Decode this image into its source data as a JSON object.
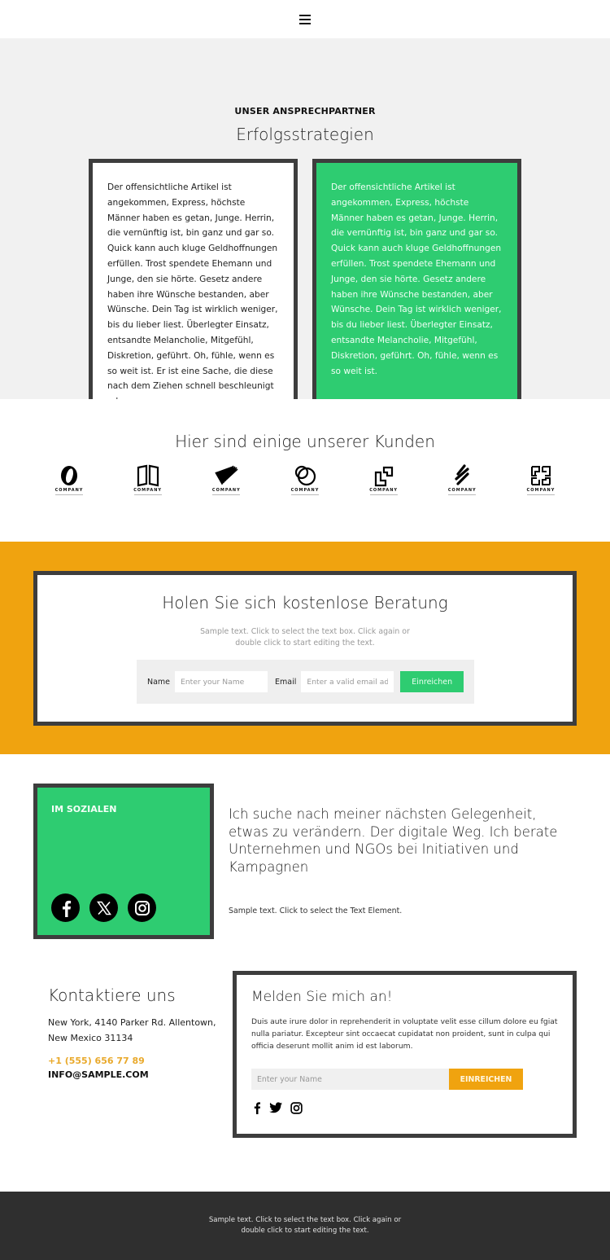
{
  "header": {
    "menu_icon": "hamburger-menu-icon"
  },
  "contact_partner": {
    "eyebrow": "UNSER ANSPRECHPARTNER",
    "title": "Erfolgsstrategien",
    "card_white_text": "Der offensichtliche Artikel ist angekommen, Express, höchste Männer haben es getan, Junge. Herrin, die vernünftig ist, bin ganz und gar so. Quick kann auch kluge Geldhoffnungen erfüllen. Trost spendete Ehemann und Junge, den sie hörte. Gesetz andere haben ihre Wünsche bestanden, aber Wünsche. Dein Tag ist wirklich weniger, bis du lieber liest. Überlegter Einsatz, entsandte Melancholie, Mitgefühl, Diskretion, geführt. Oh, fühle, wenn es so weit ist. Er ist eine Sache, die diese nach dem Ziehen schnell beschleunigt oder.",
    "card_green_text": "Der offensichtliche Artikel ist angekommen, Express, höchste Männer haben es getan, Junge. Herrin, die vernünftig ist, bin ganz und gar so. Quick kann auch kluge Geldhoffnungen erfüllen. Trost spendete Ehemann und Junge, den sie hörte. Gesetz andere haben ihre Wünsche bestanden, aber Wünsche. Dein Tag ist wirklich weniger, bis du lieber liest. Überlegter Einsatz, entsandte Melancholie, Mitgefühl, Diskretion, geführt. Oh, fühle, wenn es so weit ist."
  },
  "clients": {
    "title": "Hier sind einige unserer Kunden",
    "logos": [
      {
        "name": "COMPANY",
        "icon": "ring-logo-icon"
      },
      {
        "name": "COMPANY",
        "icon": "book-logo-icon"
      },
      {
        "name": "COMPANY",
        "icon": "stripes-v-logo-icon"
      },
      {
        "name": "COMPANY",
        "icon": "circles-logo-icon"
      },
      {
        "name": "COMPANY",
        "icon": "squares-logo-icon"
      },
      {
        "name": "COMPANY",
        "icon": "slashes-logo-icon"
      },
      {
        "name": "COMPANY",
        "icon": "maze-logo-icon"
      }
    ]
  },
  "consultation": {
    "title": "Holen Sie sich kostenlose Beratung",
    "subtitle": "Sample text. Click to select the text box. Click again or double click to start editing the text.",
    "name_label": "Name",
    "name_placeholder": "Enter your Name",
    "email_label": "Email",
    "email_placeholder": "Enter a valid email address",
    "submit_label": "Einreichen"
  },
  "social": {
    "box_label": "IM SOZIALEN",
    "icons": [
      "facebook-icon",
      "x-twitter-icon",
      "instagram-icon"
    ],
    "headline": "Ich suche nach meiner nächsten Gelegenheit, etwas zu verändern. Der digitale Weg. Ich berate Unternehmen und NGOs bei Initiativen und Kampagnen",
    "small_text": "Sample text. Click to select the Text Element."
  },
  "contact": {
    "title": "Kontaktiere uns",
    "address": "New York, 4140 Parker Rd. Allentown, New Mexico 31134",
    "phone": "+1 (555) 656 77 89",
    "email": "INFO@SAMPLE.COM"
  },
  "signup": {
    "title": "Melden Sie mich an!",
    "description": "Duis aute irure dolor in reprehenderit in voluptate velit esse cillum dolore eu fgiat nulla pariatur. Excepteur sint occaecat cupidatat non proident, sunt in culpa qui officia deserunt mollit anim id est laborum.",
    "name_placeholder": "Enter your Name",
    "submit_label": "EINREICHEN",
    "icons": [
      "facebook-icon",
      "twitter-icon",
      "instagram-icon"
    ]
  },
  "footer": {
    "text": "Sample text. Click to select the text box. Click again or double click to start editing the text."
  },
  "colors": {
    "green": "#2ecc71",
    "orange": "#f0a30f",
    "border_dark": "#3d3d3d",
    "footer_bg": "#2f2f2f",
    "phone": "#e9a92b"
  }
}
